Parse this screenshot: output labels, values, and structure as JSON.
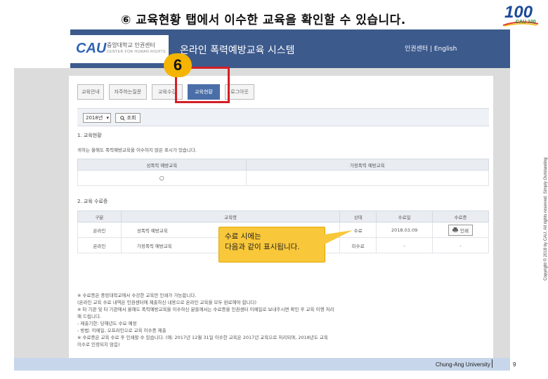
{
  "slide": {
    "title": "⑥ 교육현황 탭에서 이수한 교육을 확인할 수 있습니다.",
    "step_number": "6",
    "copyright": "Copyright © 2018 by CAU. All rights reserved. Simply Outstanding"
  },
  "logo": {
    "number": "100",
    "tagline": "CAU 100"
  },
  "header": {
    "brand_short": "CAU",
    "brand_name_ko": "중앙대학교 인권센터",
    "brand_name_en": "CENTER FOR HUMAN RIGHTS",
    "system_title": "온라인 폭력예방교육 시스템",
    "lang_links": "인권센터 | English"
  },
  "tabs": [
    {
      "label": "교육안내"
    },
    {
      "label": "자주하는질문"
    },
    {
      "label": "교육수강"
    },
    {
      "label": "교육현황"
    },
    {
      "label": "로그아웃"
    }
  ],
  "filter": {
    "year": "2018년",
    "search_label": "조회"
  },
  "section1": {
    "heading": "1. 교육현황",
    "desc": "귀하는 올해도 폭력예방교육을 이수하지 않은 표시가 있습니다.",
    "col1": "성폭력 예방교육",
    "col2": "가정폭력 예방교육",
    "status1": "○",
    "status2": ""
  },
  "section2": {
    "heading": "2. 교육 수료증",
    "headers": [
      "구분",
      "교육명",
      "상태",
      "수료일",
      "수료증"
    ],
    "rows": [
      {
        "type": "온라인",
        "name": "성폭력 예방교육",
        "status": "수료",
        "date": "2018.03.09",
        "action": "인쇄"
      },
      {
        "type": "온라인",
        "name": "가정폭력 예방교육",
        "status": "미수료",
        "date": "-",
        "action": "-"
      }
    ]
  },
  "callout": {
    "line1": "수료 시에는",
    "line2": "다음과 같이 표시됩니다."
  },
  "notes": [
    "※ 수료증은 중앙대학교에서 수강한 교육만 인쇄가 가능합니다.",
    "(온라인 교육 수료 내역은 인권센터에 제출하신 내용으로 온라인 교육을 모두 완료해야 합니다)",
    "※ 타 기관 및 타 기관에서 올해도 폭력예방교육을 이수하신 분들께서는 수료증을 인권센터 이메일로 보내주시면 확인 후 교육 이행 처리",
    "해 드립니다.",
    "- 제출기한: 당해년도 수요 예정",
    "- 방법: 이메일, 오프라인으로 교육 이수증 제출",
    "※ 수료증은 교육 수료 후 인쇄할 수 있습니다. (예: 2017년 12월 31일 이수한 교육은 2017년 교육으로 처리되며, 2018년도 교육",
    "이수로 인정되지 않음)"
  ],
  "footer": {
    "org": "Chung-Ang University",
    "page": "9"
  }
}
